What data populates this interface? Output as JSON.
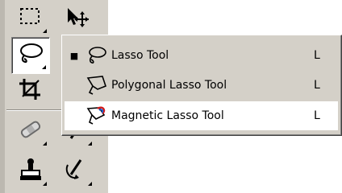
{
  "flyout": {
    "items": [
      {
        "label": "Lasso Tool",
        "shortcut": "L",
        "selected": true,
        "icon": "lasso-icon"
      },
      {
        "label": "Polygonal Lasso Tool",
        "shortcut": "L",
        "selected": false,
        "icon": "polygonal-lasso-icon"
      },
      {
        "label": "Magnetic Lasso Tool",
        "shortcut": "L",
        "selected": false,
        "icon": "magnetic-lasso-icon"
      }
    ],
    "selected_marker": "■"
  },
  "toolbar": {
    "tools": [
      {
        "name": "marquee-icon"
      },
      {
        "name": "move-icon"
      },
      {
        "name": "lasso-icon"
      },
      {
        "name": "crop-icon"
      },
      {
        "name": "healing-brush-icon"
      },
      {
        "name": "brush-icon"
      },
      {
        "name": "clone-stamp-icon"
      },
      {
        "name": "history-brush-icon"
      }
    ]
  },
  "colors": {
    "panel": "#d4d0c8",
    "highlight": "#ffffff",
    "shadow": "#808080",
    "text": "#000000"
  }
}
